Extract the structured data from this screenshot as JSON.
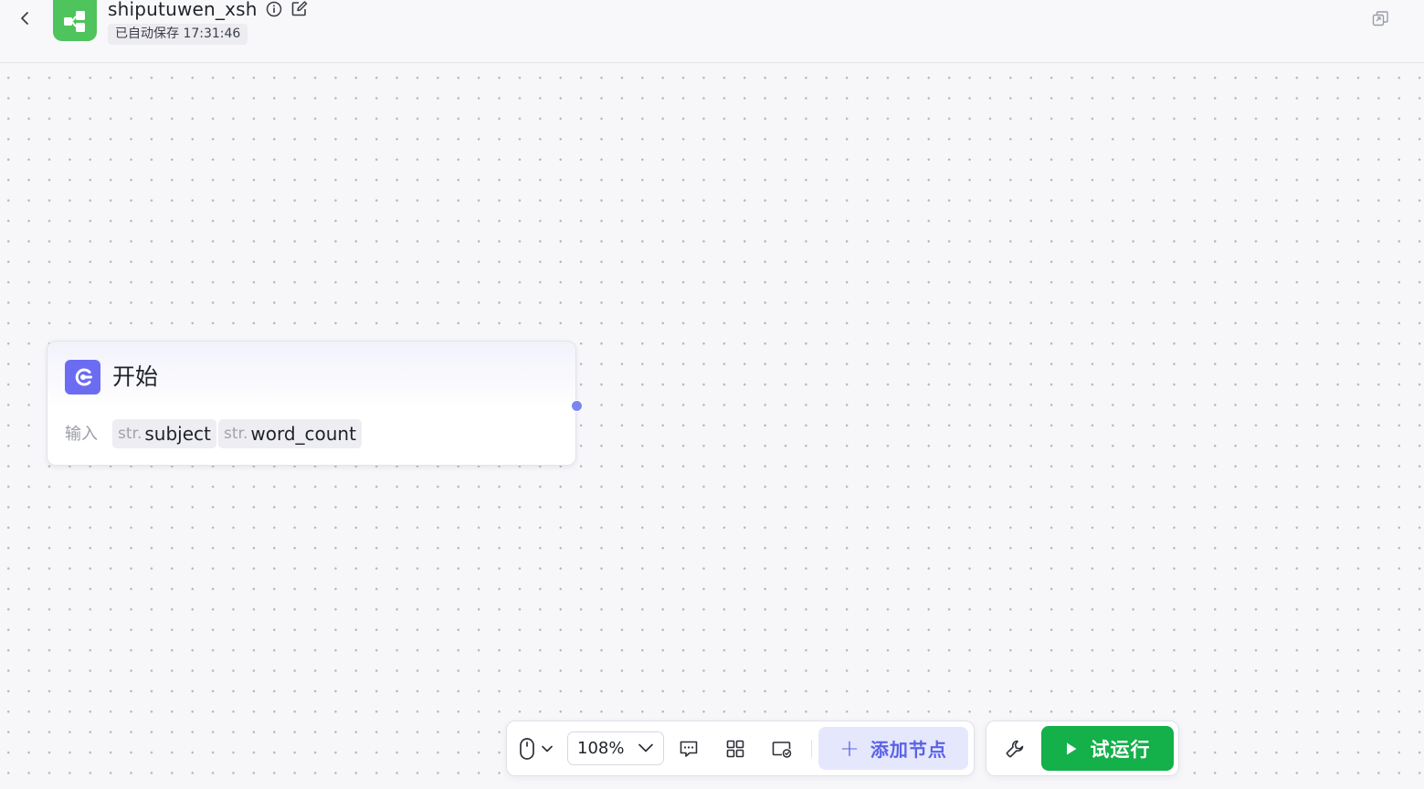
{
  "header": {
    "app_title": "shiputuwen_xsh",
    "autosave_text": "已自动保存 17:31:46"
  },
  "start_node": {
    "title": "开始",
    "inputs_label": "输入",
    "variables": [
      {
        "type": "str.",
        "name": "subject"
      },
      {
        "type": "str.",
        "name": "word_count"
      }
    ]
  },
  "toolbar": {
    "zoom_level": "108%",
    "add_node_label": "添加节点",
    "add_node_plus": "+",
    "run_label": "试运行"
  },
  "colors": {
    "app_logo": "#4fc35c",
    "node_icon": "#6c6cf2",
    "port": "#7a85ee",
    "add_node_bg": "#e5e7fc",
    "add_node_text": "#5a63e6",
    "run_button": "#14b04a"
  },
  "icons": {
    "back": "chevron-left-icon",
    "app_logo": "workflow-icon",
    "info": "info-circle-icon",
    "edit": "edit-icon",
    "window": "window-restore-icon",
    "node": "start-node-icon",
    "mouse": "mouse-icon",
    "comment": "comment-icon",
    "layout": "grid-layout-icon",
    "screen": "screen-check-icon",
    "wrench": "wrench-icon",
    "run": "play-icon"
  }
}
